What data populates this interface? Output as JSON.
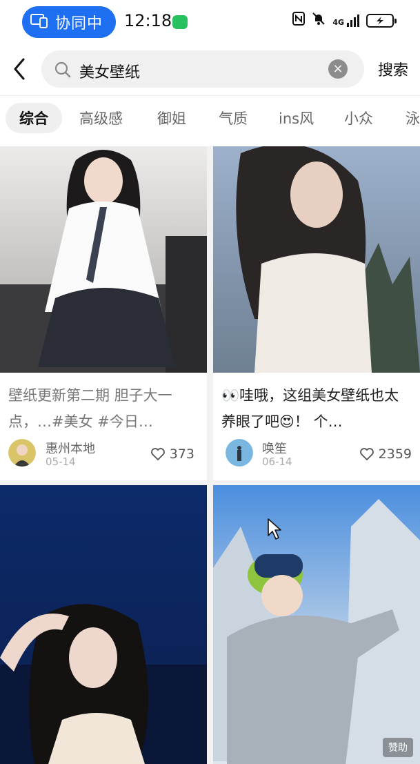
{
  "status_bar": {
    "collab_label": "协同中",
    "time": "12:18",
    "network": "4G",
    "icons": [
      "collab-icon",
      "wechat-icon",
      "nfc-icon",
      "mute-icon",
      "signal-icon",
      "battery-icon"
    ]
  },
  "search": {
    "query": "美女壁纸",
    "button_label": "搜索"
  },
  "tabs": [
    {
      "label": "综合",
      "active": true
    },
    {
      "label": "高级感"
    },
    {
      "label": "御姐"
    },
    {
      "label": "气质"
    },
    {
      "label": "ins风"
    },
    {
      "label": "小众"
    },
    {
      "label": "泳"
    }
  ],
  "cards": [
    {
      "title": "壁纸更新第二期 胆子大一点，…#美女 #今日…",
      "author": "惠州本地",
      "date": "05-14",
      "likes": "373"
    },
    {
      "title_prefix": "👀",
      "title": "哇哦，这组美女壁纸也太养眼了吧",
      "title_emoji": "😍",
      "title_suffix": "！ 个…",
      "author": "唤笙",
      "date": "06-14",
      "likes": "2359"
    },
    {
      "title": "",
      "author": "",
      "date": "",
      "likes": ""
    },
    {
      "title": "",
      "author": "",
      "date": "",
      "likes": "",
      "badge": "赞助"
    }
  ],
  "colors": {
    "accent": "#1f6ff2",
    "wechat": "#27c15e",
    "card_bg": "#ffffff",
    "page_bg": "#f2f2f2"
  }
}
